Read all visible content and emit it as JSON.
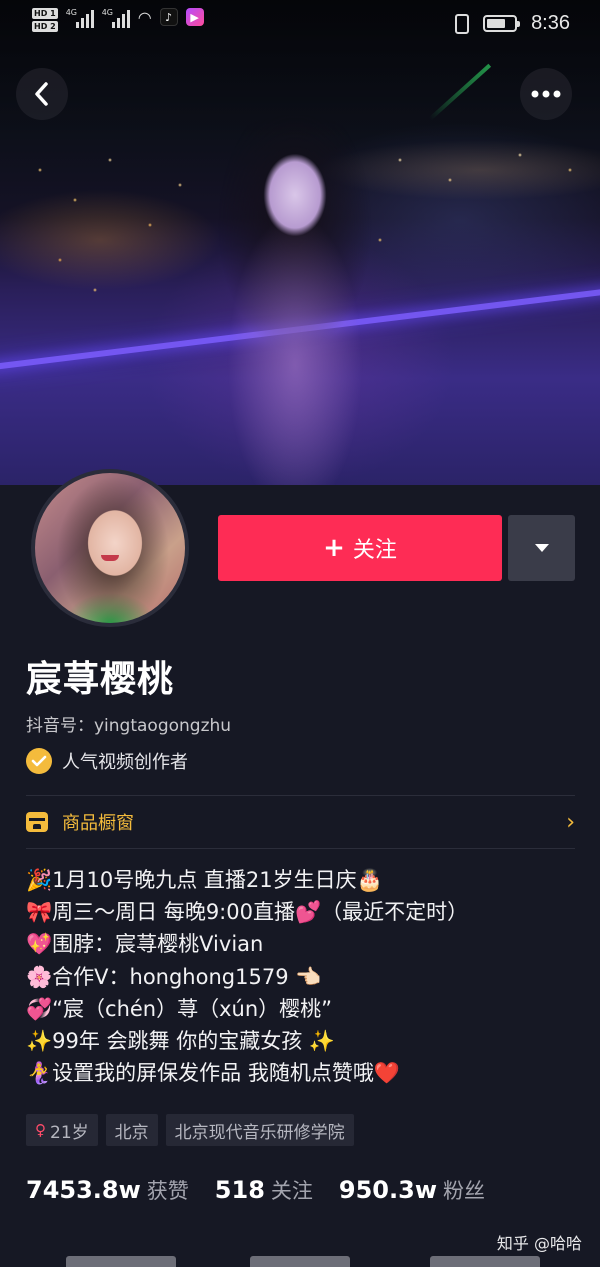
{
  "status_bar": {
    "hd_badges": [
      "HD 1",
      "HD 2"
    ],
    "network_labels": [
      "4G",
      "4G"
    ],
    "time": "8:36"
  },
  "profile": {
    "follow_label": "关注",
    "name": "宸荨樱桃",
    "douyin_id": "抖音号：yingtaogongzhu",
    "verification": "人气视频创作者"
  },
  "shop": {
    "label": "商品橱窗"
  },
  "bio": [
    "🎉1月10号晚九点 直播21岁生日庆🎂",
    "🎀周三～周日 每晚9:00直播💕（最近不定时）",
    "💖围脖：宸荨樱桃Vivian",
    "🌸合作V：honghong1579 👈🏻",
    "💞“宸（chén）荨（xún）樱桃”",
    "✨99年 会跳舞 你的宝藏女孩 ✨",
    "🧜‍♀️设置我的屏保发作品 我随机点赞哦❤️"
  ],
  "tags": {
    "age": "21岁",
    "city": "北京",
    "school": "北京现代音乐研修学院"
  },
  "stats": [
    {
      "value": "7453.8w",
      "label": "获赞"
    },
    {
      "value": "518",
      "label": "关注"
    },
    {
      "value": "950.3w",
      "label": "粉丝"
    }
  ],
  "watermark": "知乎 @哈哈",
  "colors": {
    "background": "#161824",
    "follow": "#fe2c55",
    "accent_gold": "#f4bb3c",
    "secondary_button": "#3a3c49"
  },
  "icons": {
    "back": "chevron-left-icon",
    "more": "ellipsis-icon",
    "dropdown": "triangle-down-icon",
    "verified": "check-circle-icon",
    "shop": "storefront-icon",
    "chevron": "chevron-right-icon",
    "gender": "female-icon"
  }
}
